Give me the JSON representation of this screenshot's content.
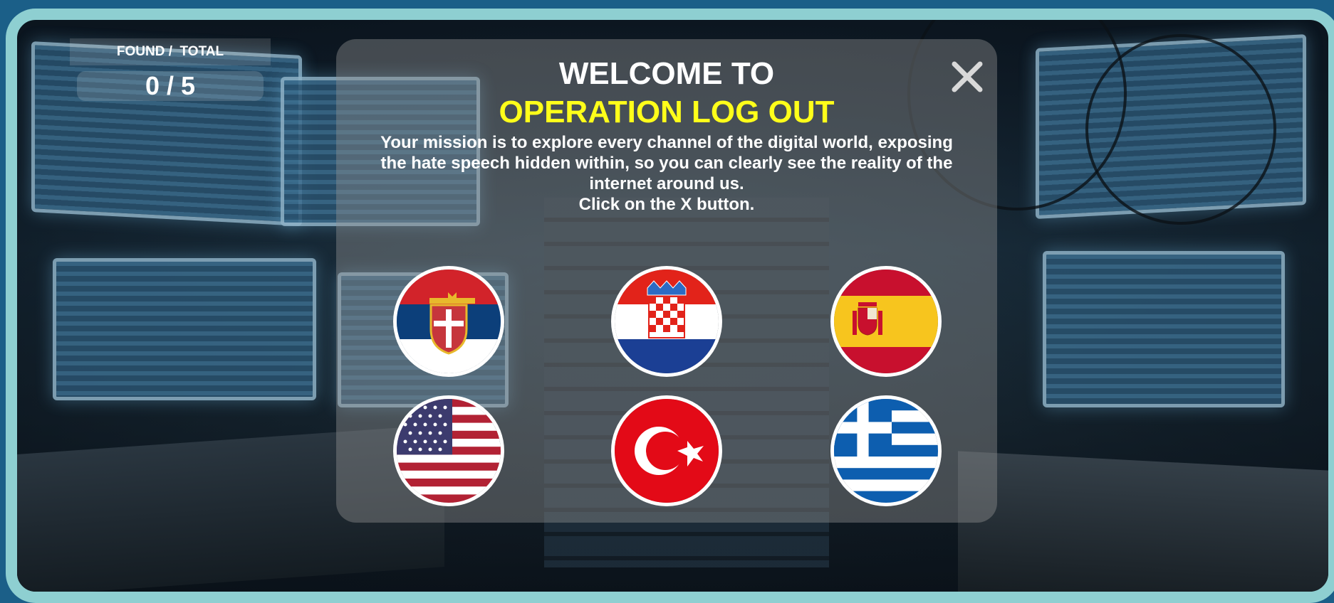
{
  "hud": {
    "counter_label": "FOUND /  TOTAL",
    "counter_value": "0 / 5"
  },
  "modal": {
    "title_line1": "WELCOME TO",
    "title_line2": "OPERATION LOG OUT",
    "message_lines": [
      "Your mission is to explore every channel of the digital world, exposing",
      "the hate speech hidden within, so you can clearly see the reality of the",
      "internet around us.",
      "Click on the X button."
    ],
    "close_icon": "close-x-icon"
  },
  "flags": [
    {
      "name": "serbia",
      "icon": "serbia-flag-icon"
    },
    {
      "name": "croatia",
      "icon": "croatia-flag-icon"
    },
    {
      "name": "spain",
      "icon": "spain-flag-icon"
    },
    {
      "name": "usa",
      "icon": "usa-flag-icon"
    },
    {
      "name": "turkey",
      "icon": "turkey-flag-icon"
    },
    {
      "name": "greece",
      "icon": "greece-flag-icon"
    }
  ],
  "colors": {
    "frame": "#8ecfd1",
    "title_accent": "#ffff1a",
    "outer_background": "#1b5f88"
  }
}
